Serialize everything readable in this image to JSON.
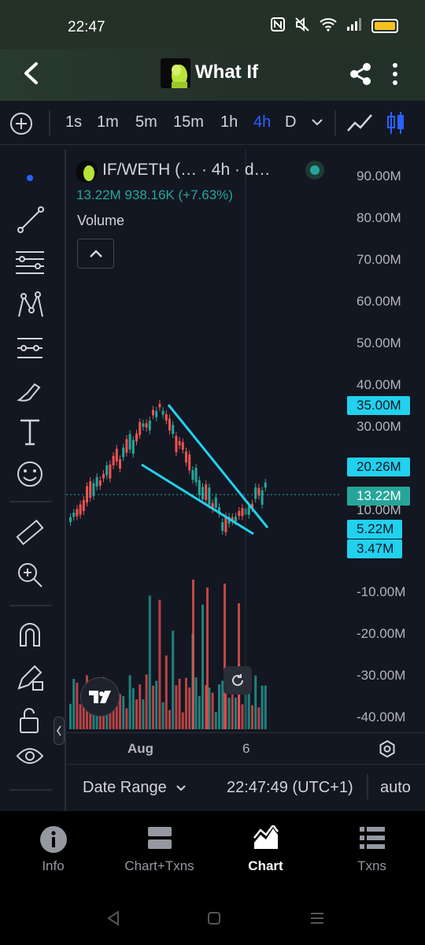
{
  "status_bar": {
    "time": "22:47"
  },
  "app_bar": {
    "title": "What If"
  },
  "timeframes": [
    "1s",
    "1m",
    "5m",
    "15m",
    "1h",
    "4h",
    "D"
  ],
  "active_timeframe": "4h",
  "legend": {
    "pair": "IF/WETH (… · 4h · d…",
    "values": "13.22M  938.16K (+7.63%)",
    "volume_label": "Volume"
  },
  "price_axis": [
    "90.00M",
    "80.00M",
    "70.00M",
    "60.00M",
    "50.00M",
    "40.00M",
    "30.00M",
    "10.00M",
    "-10.00M",
    "-20.00M",
    "-30.00M",
    "-40.00M"
  ],
  "price_tags": [
    "35.00M",
    "20.26M",
    "13.22M",
    "5.22M",
    "3.47M"
  ],
  "time_axis": [
    "Aug",
    "6"
  ],
  "bottom_bar": {
    "date_range": "Date Range",
    "clock": "22:47:49 (UTC+1)",
    "scale": "auto"
  },
  "nav": [
    {
      "label": "Info",
      "icon": "info-icon"
    },
    {
      "label": "Chart+Txns",
      "icon": "split-view-icon"
    },
    {
      "label": "Chart",
      "icon": "chart-icon"
    },
    {
      "label": "Txns",
      "icon": "list-icon"
    }
  ],
  "active_nav": "Chart",
  "colors": {
    "up": "#26a69a",
    "down": "#ef5350",
    "accent": "#2962ff",
    "tag": "#22d1ee",
    "bg": "#131722"
  }
}
